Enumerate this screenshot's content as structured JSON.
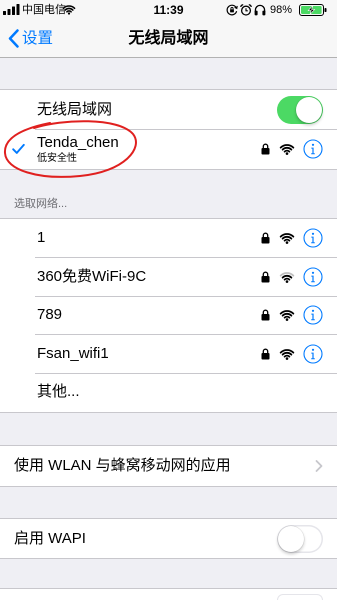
{
  "status_bar": {
    "carrier": "中国电信",
    "time": "11:39",
    "battery_text": "98%",
    "battery_level": 0.98,
    "signal_bars": 4,
    "wifi_signal": 3,
    "icons": [
      "signal-bars-icon",
      "wifi-icon",
      "rotation-lock-icon",
      "alarm-icon",
      "headphones-icon",
      "battery-charging-icon"
    ]
  },
  "nav": {
    "back_label": "设置",
    "title": "无线局域网"
  },
  "wlan": {
    "label": "无线局域网",
    "enabled": true
  },
  "connected": {
    "name": "Tenda_chen",
    "security_note": "低安全性",
    "locked": true,
    "signal": 3
  },
  "choose_header": "选取网络...",
  "networks": [
    {
      "name": "1",
      "locked": true,
      "signal": 3
    },
    {
      "name": "360免费WiFi-9C",
      "locked": true,
      "signal": 2
    },
    {
      "name": "789",
      "locked": true,
      "signal": 3
    },
    {
      "name": "Fsan_wifi1",
      "locked": true,
      "signal": 3
    }
  ],
  "other_label": "其他...",
  "apps_row": {
    "label": "使用 WLAN 与蜂窝移动网的应用"
  },
  "wapi_row": {
    "label": "启用 WAPI",
    "enabled": false
  },
  "colors": {
    "accent": "#007aff",
    "toggle_on": "#4cd964",
    "annotation": "#e0201f",
    "battery_fill": "#4cd964",
    "background": "#efeff4"
  }
}
